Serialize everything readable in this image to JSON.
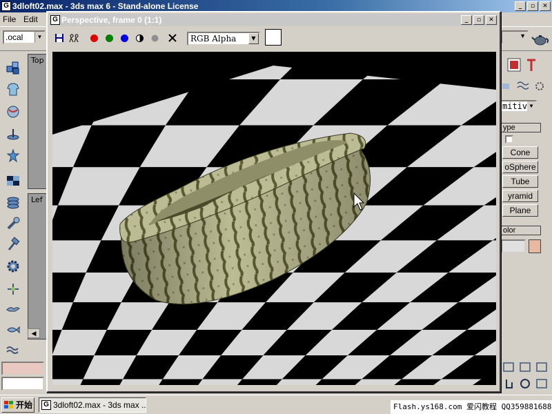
{
  "app": {
    "title": "3dloft02.max - 3ds max 6 - Stand-alone License",
    "icon_glyph": "G"
  },
  "window_buttons": {
    "minimize": "_",
    "maximize": "▫",
    "close": "✕"
  },
  "menubar": {
    "items": [
      "File",
      "Edit"
    ]
  },
  "main_toolbar": {
    "reference_coord": ".ocal",
    "dropdown_arrow": "▼"
  },
  "viewports": {
    "top_label": "Top",
    "left_label": "Lef"
  },
  "render_window": {
    "title": "Perspective, frame 0 (1:1)",
    "channel_display": "RGB Alpha",
    "channels": [
      {
        "name": "red-channel",
        "color": "#e00000"
      },
      {
        "name": "green-channel",
        "color": "#008000"
      },
      {
        "name": "blue-channel",
        "color": "#0000e0"
      }
    ],
    "swatch_color": "#ffffff"
  },
  "command_panel": {
    "category_dropdown": "mitiv",
    "object_type_rollout": "ype",
    "autogrid_label": "",
    "buttons": [
      "Cone",
      "oSphere",
      "Tube",
      "yramid",
      "Plane"
    ],
    "name_color_rollout": "olor",
    "object_color": "#e8b8a0"
  },
  "taskbar": {
    "start_label": "开始",
    "task_label": "3dloft02.max - 3ds max ...",
    "watermark": "Flash.ys168.com 爱闪教程 QQ359881688"
  },
  "colors": {
    "title_active": "#0a246a",
    "title_inactive": "#c8c8c8",
    "checker_light": "#d8d8d8",
    "checker_dark": "#000000",
    "melon_base": "#b8b890",
    "melon_stripe": "#5a5a32"
  }
}
